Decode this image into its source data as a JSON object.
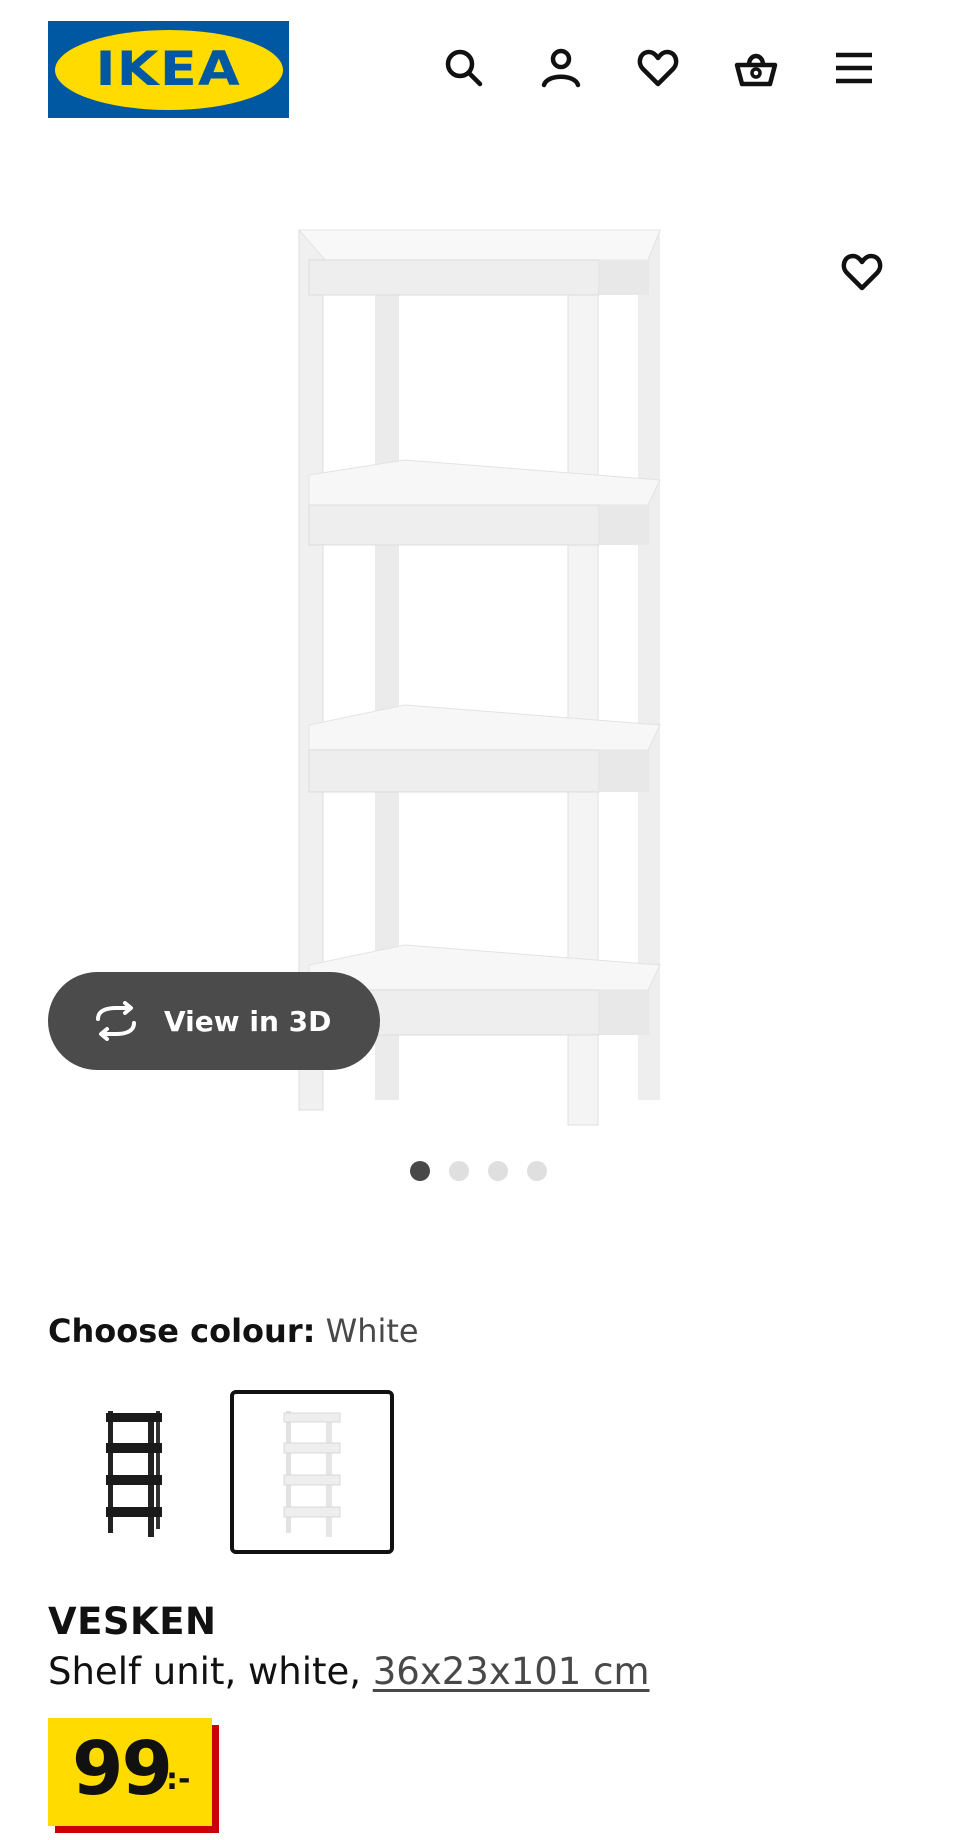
{
  "header": {
    "logo_text": "IKEA",
    "logo_registered": "®",
    "icons": [
      "search-icon",
      "account-icon",
      "favourites-icon",
      "cart-icon",
      "menu-icon"
    ]
  },
  "gallery": {
    "view_3d_label": "View in 3D",
    "slide_count": 4,
    "active_slide": 1
  },
  "colour": {
    "label": "Choose colour:",
    "selected": "White",
    "options": [
      "black",
      "white"
    ]
  },
  "product": {
    "name": "VESKEN",
    "description_prefix": "Shelf unit, white, ",
    "dimensions": "36x23x101 cm",
    "price_integer": "99",
    "price_suffix": ":-"
  },
  "colors": {
    "brand_blue": "#0058a3",
    "brand_yellow": "#ffdb00",
    "price_shadow": "#cc0008"
  }
}
